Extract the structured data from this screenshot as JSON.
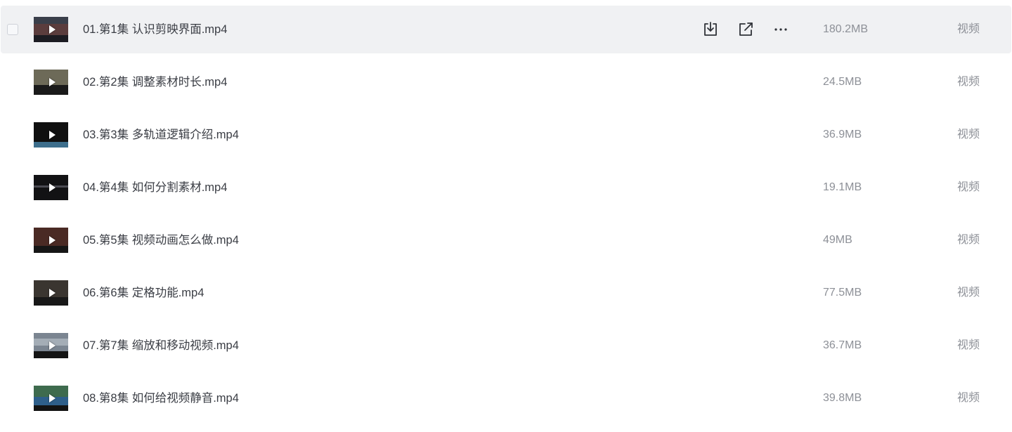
{
  "files": [
    {
      "name": "01.第1集 认识剪映界面.mp4",
      "size": "180.2MB",
      "type": "视频"
    },
    {
      "name": "02.第2集 调整素材时长.mp4",
      "size": "24.5MB",
      "type": "视频"
    },
    {
      "name": "03.第3集 多轨道逻辑介绍.mp4",
      "size": "36.9MB",
      "type": "视频"
    },
    {
      "name": "04.第4集 如何分割素材.mp4",
      "size": "19.1MB",
      "type": "视频"
    },
    {
      "name": "05.第5集 视频动画怎么做.mp4",
      "size": "49MB",
      "type": "视频"
    },
    {
      "name": "06.第6集 定格功能.mp4",
      "size": "77.5MB",
      "type": "视频"
    },
    {
      "name": "07.第7集 缩放和移动视频.mp4",
      "size": "36.7MB",
      "type": "视频"
    },
    {
      "name": "08.第8集 如何给视频静音.mp4",
      "size": "39.8MB",
      "type": "视频"
    }
  ],
  "hovered_row_actions": [
    "download-icon",
    "share-icon",
    "more-icon"
  ],
  "colors": {
    "hover_background": "#f0f1f3",
    "filename_text": "#3a3d44",
    "meta_text": "#8d9097",
    "icon": "#2f3238"
  }
}
